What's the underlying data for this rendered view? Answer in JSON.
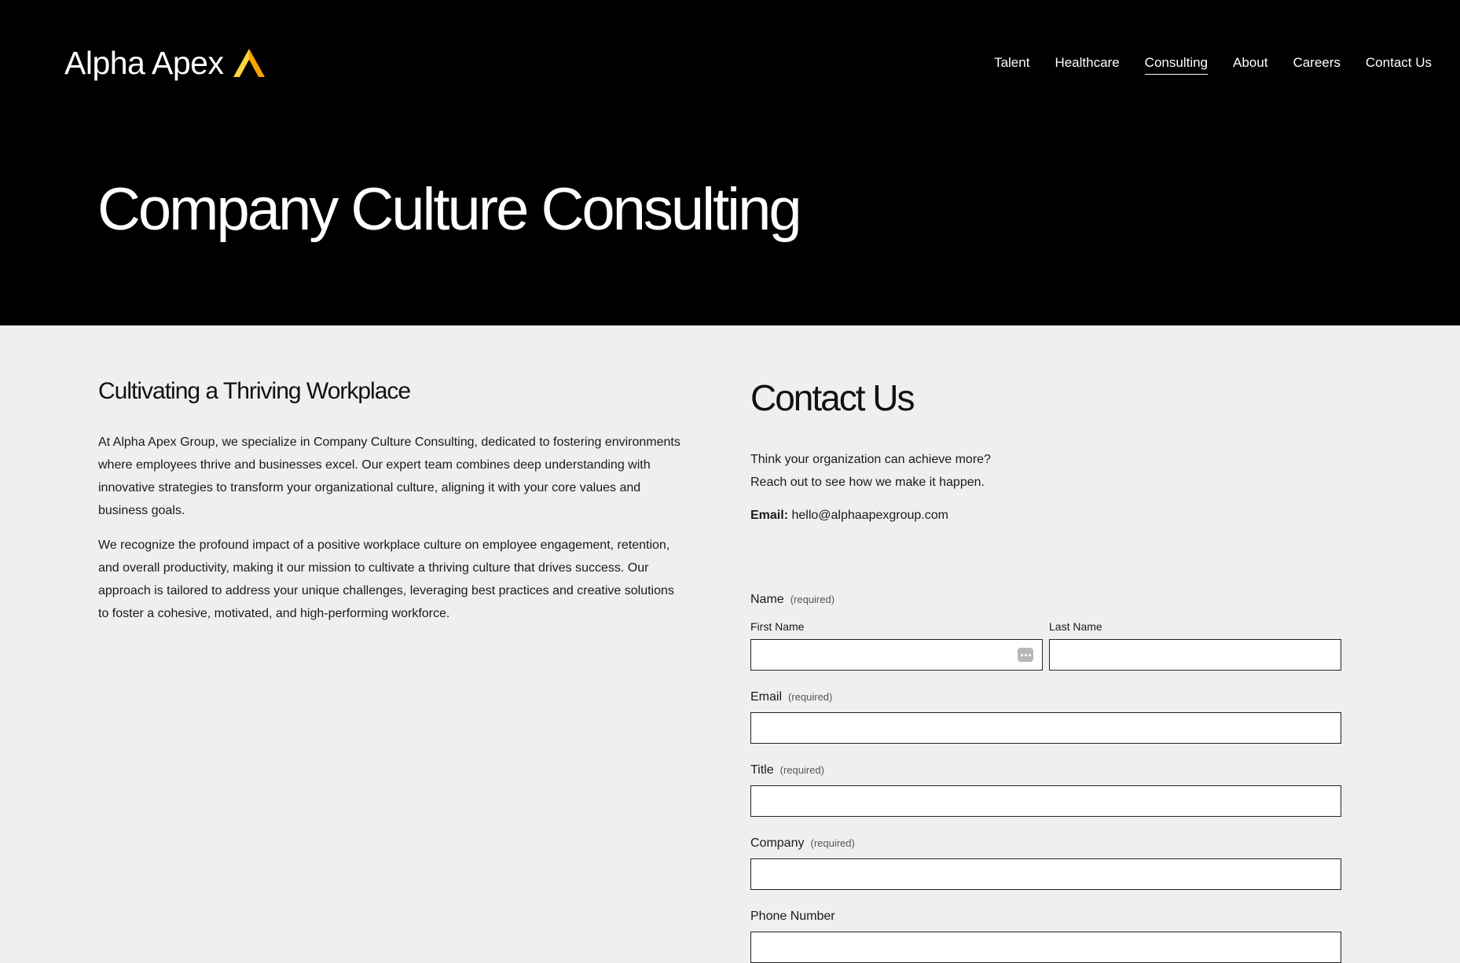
{
  "header": {
    "logo_text": "Alpha Apex",
    "logo_mark_colors": [
      "#f5a400",
      "#ffd23f"
    ],
    "nav": [
      {
        "label": "Talent",
        "active": false
      },
      {
        "label": "Healthcare",
        "active": false
      },
      {
        "label": "Consulting",
        "active": true
      },
      {
        "label": "About",
        "active": false
      },
      {
        "label": "Careers",
        "active": false
      },
      {
        "label": "Contact Us",
        "active": false
      }
    ],
    "hero_title": "Company Culture Consulting"
  },
  "about": {
    "heading": "Cultivating a Thriving Workplace",
    "paragraphs": [
      "At Alpha Apex Group, we specialize in Company Culture Consulting, dedicated to fostering environments where employees thrive and businesses excel. Our expert team combines deep understanding with innovative strategies to transform your organizational culture, aligning it with your core values and business goals.",
      "We recognize the profound impact of a positive workplace culture on employee engagement, retention, and overall productivity, making it our mission to cultivate a thriving culture that drives success. Our approach is tailored to address your unique challenges, leveraging best practices and creative solutions to foster a cohesive, motivated, and high-performing workforce."
    ]
  },
  "contact": {
    "heading": "Contact Us",
    "line1": "Think your organization can achieve more?",
    "line2": "Reach out to see how we make it happen.",
    "email_label": "Email:",
    "email_value": "hello@alphaapexgroup.com"
  },
  "form": {
    "name_label": "Name",
    "required_text": "(required)",
    "first_name_label": "First Name",
    "first_name_value": "",
    "last_name_label": "Last Name",
    "last_name_value": "",
    "email_label": "Email",
    "email_value": "",
    "title_label": "Title",
    "title_value": "",
    "company_label": "Company",
    "company_value": "",
    "phone_label": "Phone Number",
    "phone_value": ""
  },
  "colors": {
    "hero_bg": "#000000",
    "page_bg": "#efefef",
    "accent": "#f5a400"
  }
}
